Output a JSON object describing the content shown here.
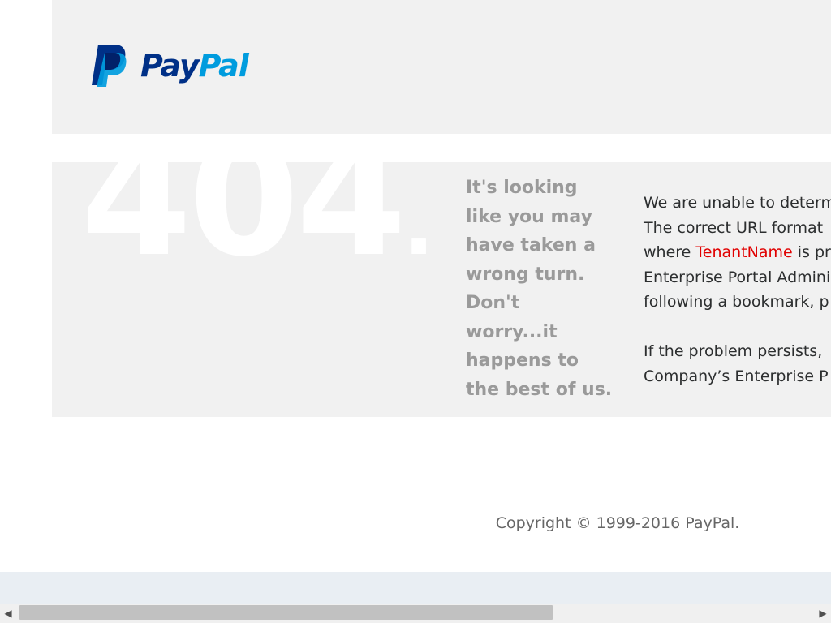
{
  "header": {
    "logo": {
      "pay": "Pay",
      "pal": "Pal",
      "colors": {
        "dark_blue": "#003087",
        "light_blue": "#009cde"
      },
      "icon": "paypal-p-icon"
    }
  },
  "error": {
    "code": "404",
    "dot": ".",
    "tagline_lines": [
      "It's looking",
      "like you may",
      "have taken a",
      "wrong turn.",
      "Don't",
      "worry...it",
      "happens to",
      "the best of us."
    ],
    "message": {
      "line1": "We are unable to determ",
      "line2": "The correct URL format",
      "line3_prefix": "where ",
      "line3_highlight": "TenantName",
      "line3_suffix": " is pr",
      "line4": "Enterprise Portal Admini",
      "line5": "following a bookmark, p",
      "line6": "If the problem persists,",
      "line7": "Company’s Enterprise P",
      "highlight_color": "#e10000"
    }
  },
  "footer": {
    "copyright": "Copyright © 1999-2016 PayPal."
  },
  "scrollbar": {
    "left_arrow": "◀",
    "right_arrow": "▶"
  },
  "colors": {
    "panel_bg": "#f1f1f1",
    "tagline": "#9a9a9a",
    "text": "#2c2e2f",
    "footer_band": "#e9eef3"
  }
}
